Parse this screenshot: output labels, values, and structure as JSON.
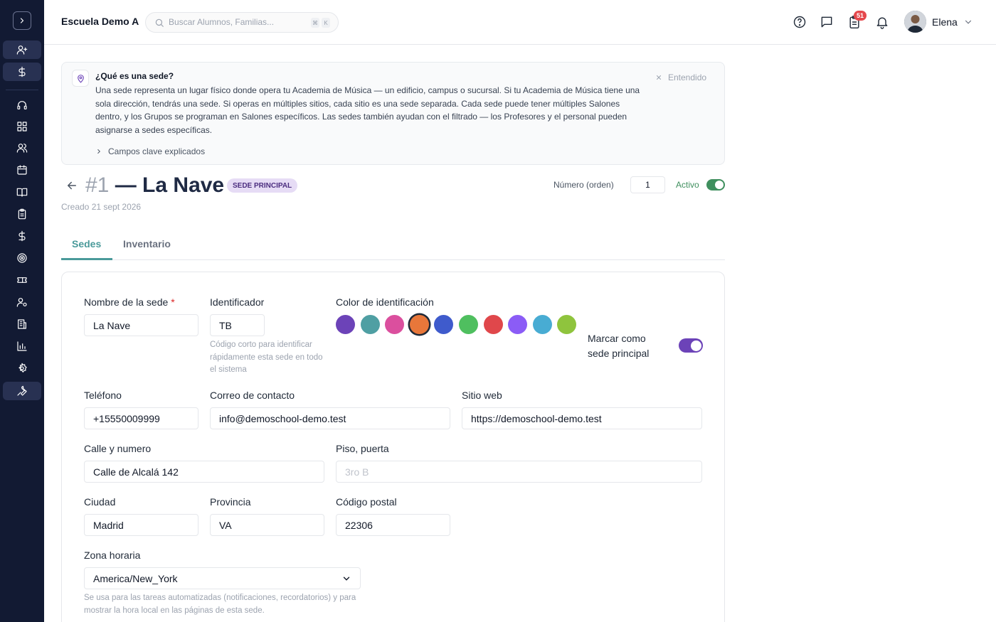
{
  "header": {
    "school": "Escuela Demo A",
    "search_placeholder": "Buscar Alumnos, Familias...",
    "kbd1": "⌘",
    "kbd2": "K",
    "badge": "51",
    "user": "Elena"
  },
  "info": {
    "title": "¿Qué es una sede?",
    "body": "Una sede representa un lugar físico donde opera tu Academia de Música — un edificio, campus o sucursal. Si tu Academia de Música tiene una sola dirección, tendrás una sede. Si operas en múltiples sitios, cada sitio es una sede separada. Cada sede puede tener múltiples Salones dentro, y los Grupos se programan en Salones específicos. Las sedes también ayudan con el filtrado — los Profesores y el personal pueden asignarse a sedes específicas.",
    "dismiss": "Entendido",
    "expand": "Campos clave explicados"
  },
  "page": {
    "number": "#1",
    "title": "— La Nave",
    "pill": "SEDE PRINCIPAL",
    "created": "Creado 21 sept 2026",
    "order_label": "Número (orden)",
    "order_value": "1",
    "active_label": "Activo"
  },
  "tabs": [
    {
      "label": "Sedes"
    },
    {
      "label": "Inventario"
    }
  ],
  "form": {
    "name_label": "Nombre de la sede",
    "name_required": "*",
    "name_value": "La Nave",
    "id_label": "Identificador",
    "id_value": "TB",
    "id_hint": "Código corto para identificar rápidamente esta sede en todo el sistema",
    "color_label": "Color de identificación",
    "colors": [
      "#6c43b8",
      "#4f9fa3",
      "#db4f9e",
      "#e8773a",
      "#3f5bcc",
      "#4fbf5f",
      "#e0474b",
      "#8b5cf6",
      "#48acd3",
      "#8fc43d"
    ],
    "selected_color": 3,
    "principal_label": "Marcar como sede principal",
    "principal_on": true,
    "phone_label": "Teléfono",
    "phone_value": "+15550009999",
    "email_label": "Correo de contacto",
    "email_value": "info@demoschool-demo.test",
    "web_label": "Sitio web",
    "web_value": "https://demoschool-demo.test",
    "street_label": "Calle y numero",
    "street_value": "Calle de Alcalá 142",
    "floor_label": "Piso, puerta",
    "floor_placeholder": "3ro B",
    "city_label": "Ciudad",
    "city_value": "Madrid",
    "province_label": "Provincia",
    "province_value": "VA",
    "postal_label": "Código postal",
    "postal_value": "22306",
    "tz_label": "Zona horaria",
    "tz_value": "America/New_York",
    "tz_hint": "Se usa para las tareas automatizadas (notificaciones, recordatorios) y para mostrar la hora local en las páginas de esta sede."
  },
  "colors": {
    "accent_teal": "#4a9a9a",
    "toggle_green": "#3f8f5e",
    "toggle_purple": "#6c43b8",
    "sidebar_bg": "#121a33"
  }
}
